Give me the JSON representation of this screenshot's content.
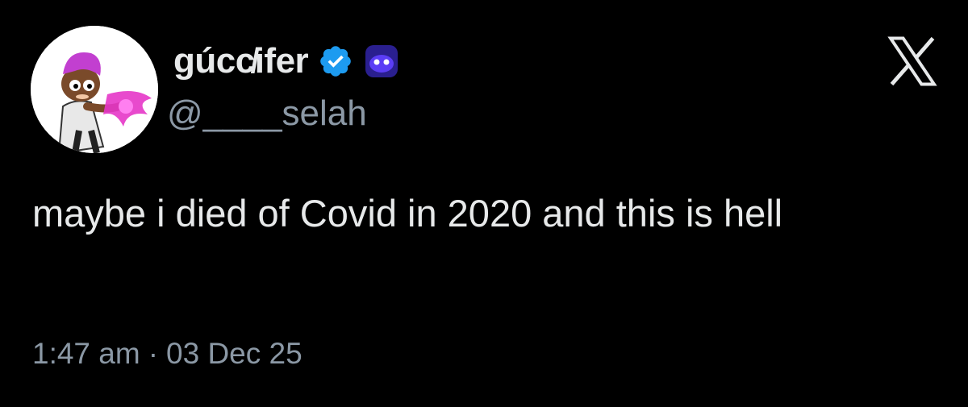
{
  "post": {
    "author": {
      "display_name": "gúcc̸ifer",
      "handle": "@____selah",
      "verified": true,
      "verified_color": "#1d9bf0",
      "badge_icon": "purple-blob-emoji",
      "avatar_icon": "cartoon-character-avatar"
    },
    "platform_icon": "x-logo-icon",
    "text": "maybe i died of Covid in 2020 and this is hell",
    "time": "1:47 am",
    "separator": "·",
    "date": "03 Dec 25"
  },
  "colors": {
    "background": "#000000",
    "primary_text": "#e7e9ea",
    "secondary_text": "#8b98a5"
  }
}
